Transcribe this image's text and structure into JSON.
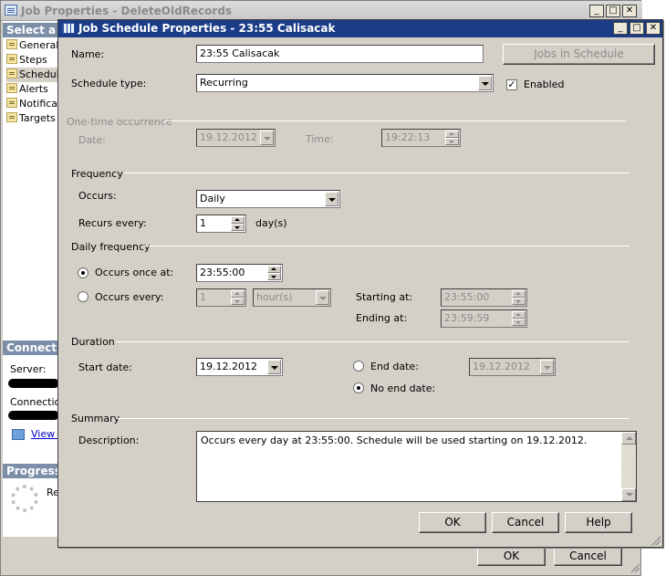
{
  "background_window": {
    "title": "Job Properties - DeleteOldRecords",
    "select_page_header": "Select a page",
    "pages": [
      {
        "label": "General",
        "icon": "page-icon"
      },
      {
        "label": "Steps",
        "icon": "page-icon"
      },
      {
        "label": "Schedules",
        "icon": "page-icon"
      },
      {
        "label": "Alerts",
        "icon": "page-icon"
      },
      {
        "label": "Notifications",
        "icon": "page-icon"
      },
      {
        "label": "Targets",
        "icon": "page-icon"
      }
    ],
    "connection_header": "Connection",
    "server_label": "Server:",
    "connection_label": "Connection:",
    "view_link": "View connection properties",
    "progress_header": "Progress",
    "progress_status": "Ready",
    "ok_label": "OK",
    "cancel_label": "Cancel"
  },
  "dialog": {
    "title": "Job Schedule Properties - 23:55 Calisacak",
    "name_label": "Name:",
    "name_value": "23:55 Calisacak",
    "jobs_in_schedule_label": "Jobs in Schedule",
    "schedule_type_label": "Schedule type:",
    "schedule_type_value": "Recurring",
    "enabled_label": "Enabled",
    "enabled_checked": true,
    "one_time": {
      "header": "One-time occurrence",
      "date_label": "Date:",
      "date_value": "19.12.2012",
      "time_label": "Time:",
      "time_value": "19:22:13"
    },
    "frequency": {
      "header": "Frequency",
      "occurs_label": "Occurs:",
      "occurs_value": "Daily",
      "recurs_label": "Recurs every:",
      "recurs_value": "1",
      "recurs_unit": "day(s)"
    },
    "daily_frequency": {
      "header": "Daily frequency",
      "once_label": "Occurs once at:",
      "once_value": "23:55:00",
      "every_label": "Occurs every:",
      "every_value": "1",
      "every_unit": "hour(s)",
      "starting_label": "Starting at:",
      "starting_value": "23:55:00",
      "ending_label": "Ending at:",
      "ending_value": "23:59:59",
      "selected": "once"
    },
    "duration": {
      "header": "Duration",
      "start_label": "Start date:",
      "start_value": "19.12.2012",
      "end_date_label": "End date:",
      "end_date_value": "19.12.2012",
      "no_end_label": "No end date:",
      "selected": "no_end"
    },
    "summary": {
      "header": "Summary",
      "description_label": "Description:",
      "description_text": "Occurs every day at 23:55:00. Schedule will be used starting on 19.12.2012."
    },
    "buttons": {
      "ok": "OK",
      "cancel": "Cancel",
      "help": "Help"
    },
    "colors": {
      "title_bar": "#1b3d87",
      "face": "#d4d0c8"
    }
  }
}
